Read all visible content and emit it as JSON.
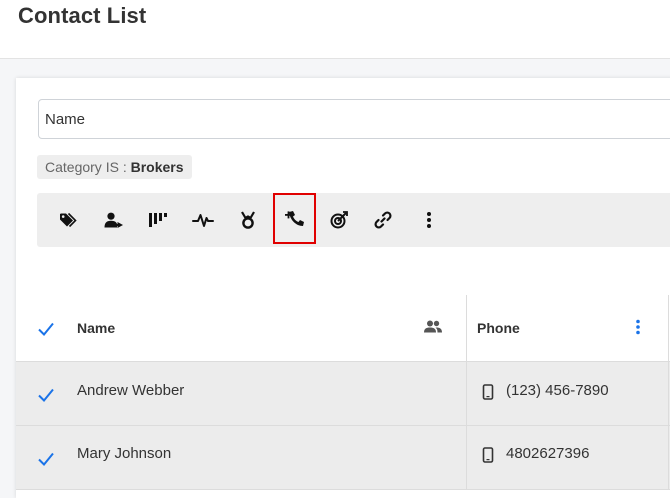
{
  "page": {
    "title": "Contact List"
  },
  "search": {
    "placeholder": "Name"
  },
  "filter": {
    "label": "Category IS :",
    "value": "Brokers"
  },
  "toolbar": {
    "buttons": [
      {
        "icon": "tag-icon"
      },
      {
        "icon": "assign-user-icon"
      },
      {
        "icon": "pipeline-icon"
      },
      {
        "icon": "activity-icon"
      },
      {
        "icon": "award-icon"
      },
      {
        "icon": "add-call-icon"
      },
      {
        "icon": "target-icon"
      },
      {
        "icon": "link-icon"
      },
      {
        "icon": "more-vertical-icon"
      }
    ],
    "highlight_color": "#e00000"
  },
  "table": {
    "columns": {
      "name": "Name",
      "phone": "Phone"
    },
    "rows": [
      {
        "name": "Andrew Webber",
        "phone": "(123) 456-7890",
        "checked": true
      },
      {
        "name": "Mary Johnson",
        "phone": "4802627396",
        "checked": true
      }
    ]
  },
  "colors": {
    "accent": "#1a73e8",
    "row_bg": "#ececec",
    "toolbar_bg": "#eeeeee"
  }
}
